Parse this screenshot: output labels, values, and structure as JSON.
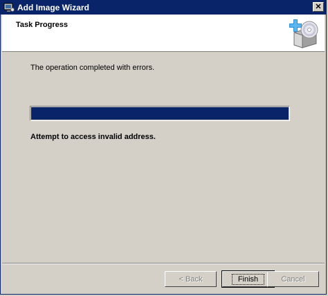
{
  "window": {
    "title": "Add Image Wizard",
    "app_icon": "monitor-icon",
    "close_glyph": "✕"
  },
  "header": {
    "title": "Task Progress",
    "icon": "image-disc-add-icon"
  },
  "main": {
    "status_message": "The operation completed with errors.",
    "progress_fraction": 1.0,
    "error_message": "Attempt to access invalid address."
  },
  "buttons": {
    "back_label": "< Back",
    "finish_label": "Finish",
    "cancel_label": "Cancel"
  },
  "colors": {
    "titlebar": "#0a246a",
    "progress": "#0a246a",
    "dialog_bg": "#d4d0c8"
  }
}
